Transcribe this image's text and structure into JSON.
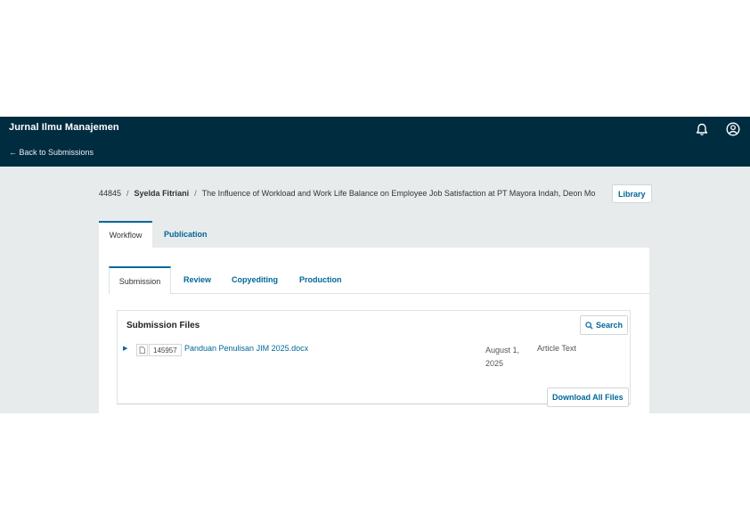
{
  "header": {
    "site_title": "Jurnal Ilmu Manajemen",
    "back_link": "← Back to Submissions",
    "icons": [
      "bell-icon",
      "user-circle-icon"
    ]
  },
  "breadcrumb": {
    "id": "44845",
    "separator": "/",
    "author": "Syelda Fitriani",
    "title": "The Influence of Workload and Work Life Balance on Employee Job Satisfaction at PT Mayora Indah, Deon Mo"
  },
  "library_label": "Library",
  "main_tabs": [
    {
      "label": "Workflow",
      "active": true
    },
    {
      "label": "Publication",
      "active": false
    }
  ],
  "sub_tabs": [
    {
      "label": "Submission",
      "active": true
    },
    {
      "label": "Review",
      "active": false
    },
    {
      "label": "Copyediting",
      "active": false
    },
    {
      "label": "Production",
      "active": false
    }
  ],
  "submission_files": {
    "title": "Submission Files",
    "search_label": "Search",
    "files": [
      {
        "id": "145957",
        "name": "Panduan Penulisan JIM 2025.docx",
        "date": "August 1, 2025",
        "type": "Article Text"
      }
    ],
    "download_all_label": "Download All Files"
  },
  "colors": {
    "header_bg": "#002c40",
    "accent": "#006798",
    "page_bg": "#e8ebec"
  }
}
